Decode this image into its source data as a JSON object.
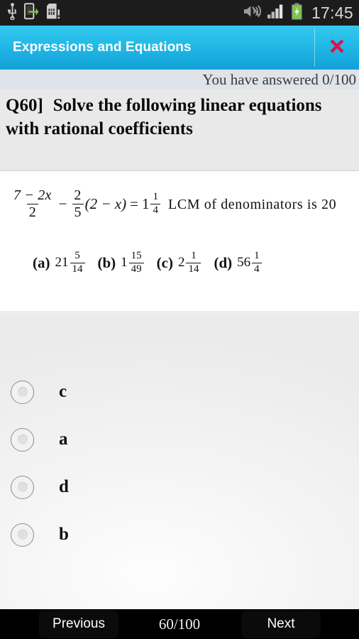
{
  "statusbar": {
    "clock": "17:45",
    "left_icons": [
      {
        "name": "usb-icon"
      },
      {
        "name": "usb-file-transfer-icon"
      },
      {
        "name": "sim-card-alert-icon"
      }
    ],
    "right_icons": [
      {
        "name": "sound-muted-icon"
      },
      {
        "name": "signal-bars-icon",
        "bars": 4
      },
      {
        "name": "battery-charging-icon",
        "color": "#7ac943"
      }
    ]
  },
  "titlebar": {
    "title": "Expressions and Equations",
    "close_label": "✕",
    "accent_top": "#35c8ee",
    "accent_bottom": "#12a0d8",
    "close_color": "#e0114b"
  },
  "progress": {
    "answered_text": "You have answered 0/100"
  },
  "question": {
    "number": "Q60]",
    "text": "Solve the following linear equations with rational coefficients",
    "equation": {
      "frac1_num": "7 − 2x",
      "frac1_den": "2",
      "minus": "−",
      "frac2_num": "2",
      "frac2_den": "5",
      "paren": "(2 − x)",
      "equals": "=",
      "result_whole": "1",
      "result_num": "1",
      "result_den": "4"
    },
    "hint": "LCM of denominators is 20",
    "choices": [
      {
        "tag": "(a)",
        "whole": "21",
        "num": "5",
        "den": "14"
      },
      {
        "tag": "(b)",
        "whole": "1",
        "num": "15",
        "den": "49"
      },
      {
        "tag": "(c)",
        "whole": "2",
        "num": "1",
        "den": "14"
      },
      {
        "tag": "(d)",
        "whole": "56",
        "num": "1",
        "den": "4"
      }
    ]
  },
  "answers": {
    "options": [
      {
        "label": "c",
        "selected": false
      },
      {
        "label": "a",
        "selected": false
      },
      {
        "label": "d",
        "selected": false
      },
      {
        "label": "b",
        "selected": false
      }
    ]
  },
  "bottomnav": {
    "previous_label": "Previous",
    "next_label": "Next",
    "counter": "60/100"
  }
}
